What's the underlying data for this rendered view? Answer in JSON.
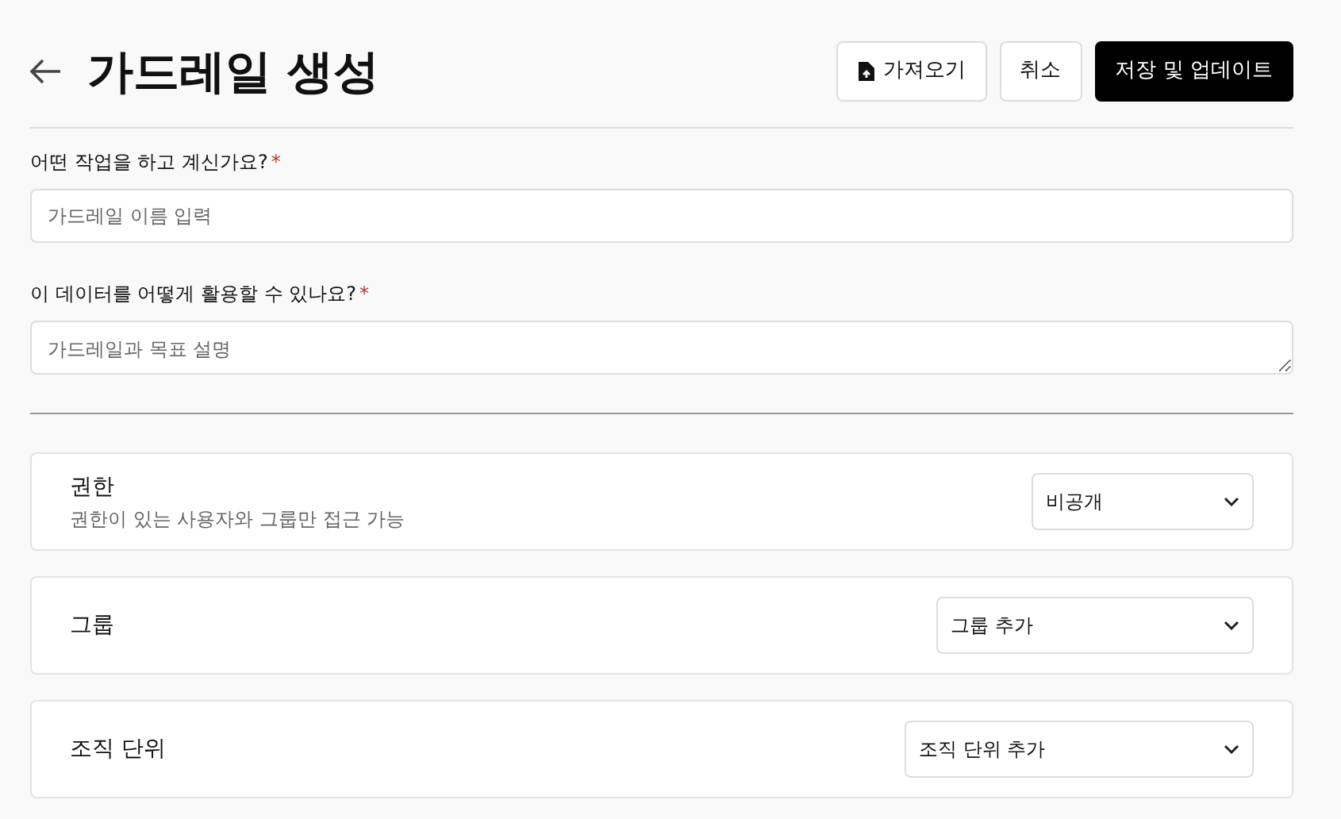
{
  "header": {
    "title": "가드레일 생성",
    "buttons": [
      {
        "label": "가져오기",
        "kind": "import"
      },
      {
        "label": "취소",
        "kind": "secondary"
      },
      {
        "label": "저장 및 업데이트",
        "kind": "primary"
      }
    ]
  },
  "fields": [
    {
      "label": "어떤 작업을 하고 계신가요?",
      "required_mark": "*",
      "kind": "input",
      "placeholder": "가드레일 이름 입력"
    },
    {
      "label": "이 데이터를 어떻게 활용할 수 있나요?",
      "required_mark": "*",
      "kind": "textarea",
      "placeholder": "가드레일과 목표 설명"
    }
  ],
  "settings": [
    {
      "title": "권한",
      "description": "권한이 있는 사용자와 그룹만 접근 가능",
      "value": "비공개"
    },
    {
      "title": "그룹",
      "value": "그룹 추가"
    },
    {
      "title": "조직 단위",
      "value": "조직 단위 추가"
    }
  ]
}
